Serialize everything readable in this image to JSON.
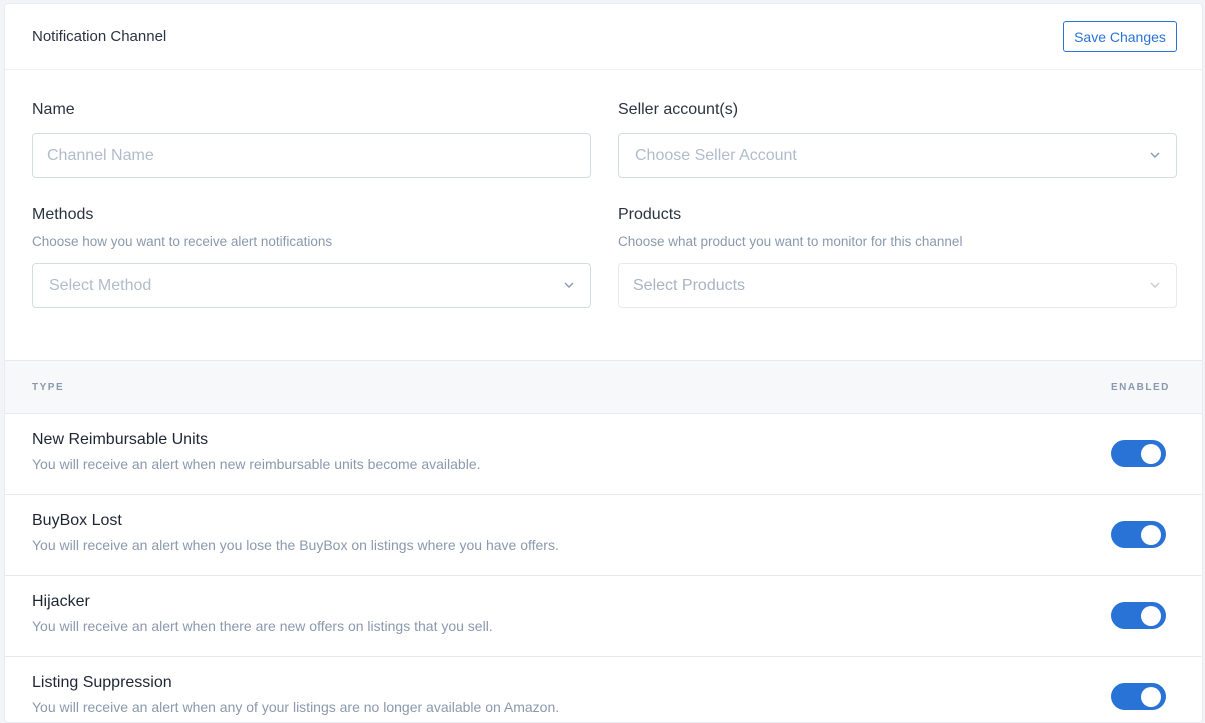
{
  "header": {
    "title": "Notification Channel",
    "save_label": "Save Changes"
  },
  "form": {
    "name": {
      "label": "Name",
      "placeholder": "Channel Name"
    },
    "seller": {
      "label": "Seller account(s)",
      "placeholder": "Choose Seller Account"
    },
    "methods": {
      "label": "Methods",
      "help": "Choose how you want to receive alert notifications",
      "placeholder": "Select Method"
    },
    "products": {
      "label": "Products",
      "help": "Choose what product you want to monitor for this channel",
      "placeholder": "Select Products"
    }
  },
  "table": {
    "col_type": "TYPE",
    "col_enabled": "ENABLED",
    "rows": [
      {
        "title": "New Reimbursable Units",
        "desc": "You will receive an alert when new reimbursable units become available.",
        "enabled": true
      },
      {
        "title": "BuyBox Lost",
        "desc": "You will receive an alert when you lose the BuyBox on listings where you have offers.",
        "enabled": true
      },
      {
        "title": "Hijacker",
        "desc": "You will receive an alert when there are new offers on listings that you sell.",
        "enabled": true
      },
      {
        "title": "Listing Suppression",
        "desc": "You will receive an alert when any of your listings are no longer available on Amazon.",
        "enabled": true
      }
    ]
  },
  "colors": {
    "accent": "#2a73d6",
    "muted": "#8a99ad"
  },
  "icons": {
    "dropdown": "chevron-down-icon"
  }
}
